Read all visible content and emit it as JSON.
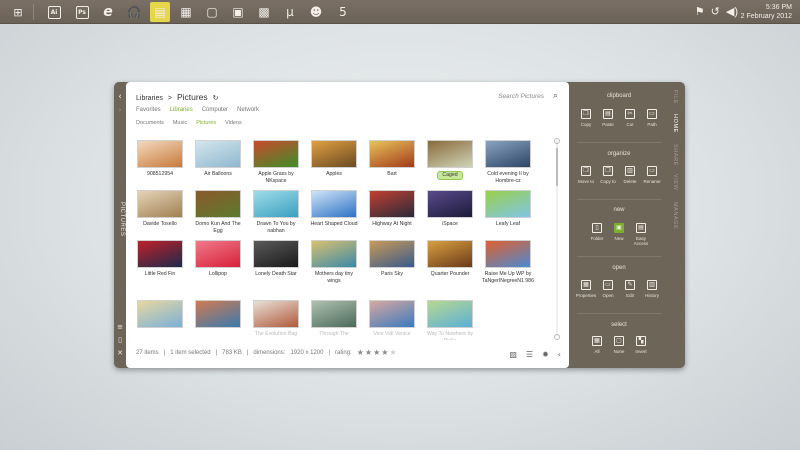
{
  "taskbar": {
    "start_icon": "windows-logo-icon",
    "apps": [
      {
        "name": "illustrator-icon",
        "glyph": "Ai"
      },
      {
        "name": "photoshop-icon",
        "glyph": "Ps"
      },
      {
        "name": "internet-explorer-icon",
        "glyph": "e"
      },
      {
        "name": "headphones-icon",
        "glyph": "🎧"
      },
      {
        "name": "notes-app-icon",
        "glyph": "▤"
      },
      {
        "name": "calculator-icon",
        "glyph": "▦"
      },
      {
        "name": "window-app-icon",
        "glyph": "▢"
      },
      {
        "name": "chat-app-icon",
        "glyph": "▣"
      },
      {
        "name": "photo-app-icon",
        "glyph": "▩"
      },
      {
        "name": "utorrent-icon",
        "glyph": "µ"
      },
      {
        "name": "users-app-icon",
        "glyph": "☻"
      },
      {
        "name": "html5-icon",
        "glyph": "5"
      }
    ],
    "time": "5:36 PM",
    "date": "2 February 2012"
  },
  "rail": {
    "back": "‹",
    "label": "PICTURES",
    "bottom": [
      "≡",
      "▯",
      "✕"
    ]
  },
  "explorer": {
    "breadcrumb": {
      "root": "Libraries",
      "sep": ">",
      "current": "Pictures",
      "refresh": "↻"
    },
    "search": {
      "placeholder": "Search Pictures"
    },
    "nav1": [
      "Favorites",
      "Libraries",
      "Computer",
      "Network"
    ],
    "nav2": [
      "Documents",
      "Music",
      "Pictures",
      "Videos"
    ],
    "items": [
      {
        "caption": "908512954",
        "c1": "#c87a3a",
        "c2": "#f3d9c0"
      },
      {
        "caption": "Air Balloons",
        "c1": "#8fb7cf",
        "c2": "#d4e6ee"
      },
      {
        "caption": "Apple Grass by NKspace",
        "c1": "#3e8e2a",
        "c2": "#c94a2c"
      },
      {
        "caption": "Apples",
        "c1": "#6b4a25",
        "c2": "#e0a040"
      },
      {
        "caption": "Bart",
        "c1": "#a33a1a",
        "c2": "#e7c35a"
      },
      {
        "caption": "Caged",
        "c1": "#cfd4b8",
        "c2": "#8a6a3a",
        "selected": true
      },
      {
        "caption": "Cold evening II by Hombre-cz",
        "c1": "#2c4566",
        "c2": "#8aa3c2"
      },
      {
        "caption": "Davide Tosello",
        "c1": "#a08050",
        "c2": "#e5d4b8"
      },
      {
        "caption": "Domo Kun And The Egg",
        "c1": "#5c7a2e",
        "c2": "#8a5a2a"
      },
      {
        "caption": "Drawn To You by nabhan",
        "c1": "#3a9fbf",
        "c2": "#9fdcea"
      },
      {
        "caption": "Heart Shaped Cloud",
        "c1": "#2d72c4",
        "c2": "#cfe4f8"
      },
      {
        "caption": "Highway At Night",
        "c1": "#2a2a3a",
        "c2": "#c04030"
      },
      {
        "caption": "iSpace",
        "c1": "#1b1b3a",
        "c2": "#5a4a8a"
      },
      {
        "caption": "Leafy Leaf",
        "c1": "#7fc5e8",
        "c2": "#9ad04a"
      },
      {
        "caption": "Little Red Fin",
        "c1": "#1c2a4a",
        "c2": "#c0202a"
      },
      {
        "caption": "Lollipop",
        "c1": "#d8203a",
        "c2": "#f07a8a"
      },
      {
        "caption": "Lonely Death Star",
        "c1": "#1a1a1a",
        "c2": "#5a5a5a"
      },
      {
        "caption": "Mothers day tiny wings",
        "c1": "#3a8aa8",
        "c2": "#d8c070"
      },
      {
        "caption": "Paris Sky",
        "c1": "#3a5a8a",
        "c2": "#c89a5a"
      },
      {
        "caption": "Quarter Pounder",
        "c1": "#6a3a1a",
        "c2": "#d8a040"
      },
      {
        "caption": "Raise Me Up WP by TaNgerINegreeN1 986",
        "c1": "#4a8ad0",
        "c2": "#e06030"
      },
      {
        "caption": "",
        "c1": "#7ab0d8",
        "c2": "#e8d8a0"
      },
      {
        "caption": "",
        "c1": "#3a7ab0",
        "c2": "#d07a50"
      },
      {
        "caption": "The Evolution Bag",
        "c1": "#b05a3a",
        "c2": "#e8e0d8"
      },
      {
        "caption": "Through The",
        "c1": "#4a6a5a",
        "c2": "#b0c0b0"
      },
      {
        "caption": "Veni Vidi Venice",
        "c1": "#3a7ac0",
        "c2": "#d8a8a0"
      },
      {
        "caption": "Way To Nowhere by Pielie",
        "c1": "#5ab0d8",
        "c2": "#b8d890"
      }
    ],
    "status": {
      "items": "27 items",
      "selected": "1 item selected",
      "size": "783 KB",
      "dimensions_label": "dimensions:",
      "dimensions": "1920 x 1200",
      "rating_label": "rating:",
      "rating": 4,
      "rating_max": 5
    }
  },
  "ribbon": {
    "clipboard": {
      "title": "clipboard",
      "buttons": [
        {
          "label": "Copy",
          "glyph": "❐"
        },
        {
          "label": "Paste",
          "glyph": "▤"
        },
        {
          "label": "Cut",
          "glyph": "✂"
        },
        {
          "label": "Path",
          "glyph": "▭"
        }
      ]
    },
    "organize": {
      "title": "organize",
      "buttons": [
        {
          "label": "Move to",
          "glyph": "❐"
        },
        {
          "label": "Copy to",
          "glyph": "❐"
        },
        {
          "label": "Delete",
          "glyph": "▥"
        },
        {
          "label": "Rename",
          "glyph": "▭"
        }
      ]
    },
    "new": {
      "title": "new",
      "buttons": [
        {
          "label": "Folder",
          "glyph": "▯"
        },
        {
          "label": "New",
          "glyph": "▣"
        },
        {
          "label": "Easy Access",
          "glyph": "▤"
        }
      ]
    },
    "open": {
      "title": "open",
      "buttons": [
        {
          "label": "Properties",
          "glyph": "▦"
        },
        {
          "label": "Open",
          "glyph": "▭"
        },
        {
          "label": "Edit",
          "glyph": "✎"
        },
        {
          "label": "History",
          "glyph": "▥"
        }
      ]
    },
    "select": {
      "title": "select",
      "buttons": [
        {
          "label": "All",
          "glyph": "▦"
        },
        {
          "label": "None",
          "glyph": "▢"
        },
        {
          "label": "Invert",
          "glyph": "▚"
        }
      ]
    }
  },
  "tabs": [
    "FILE",
    "HOME",
    "SHARE",
    "VIEW",
    "MANAGE"
  ],
  "active_tab": "HOME"
}
